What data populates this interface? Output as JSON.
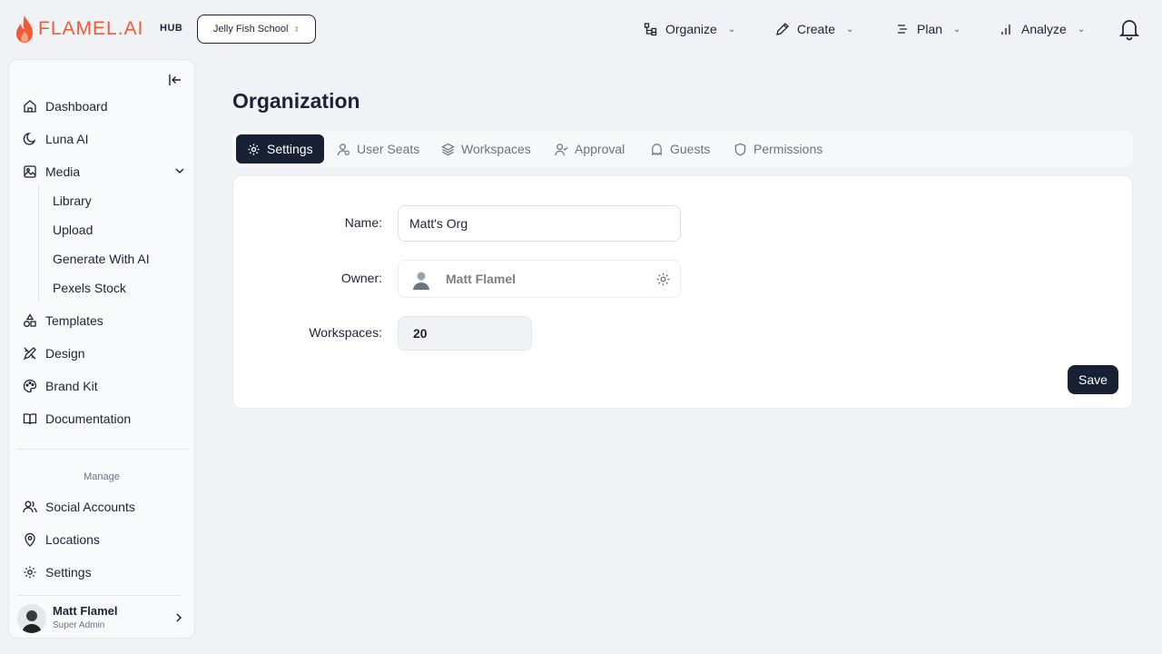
{
  "brand": {
    "logo_text": "FLAMEL.AI",
    "hub_label": "HUB",
    "accent": "#ef5a37"
  },
  "org_selector": {
    "value": "Jelly Fish School"
  },
  "topnav": [
    {
      "label": "Organize",
      "icon": "organize-icon"
    },
    {
      "label": "Create",
      "icon": "pen-icon"
    },
    {
      "label": "Plan",
      "icon": "plan-icon"
    },
    {
      "label": "Analyze",
      "icon": "bar-chart-icon"
    }
  ],
  "sidebar": {
    "items": [
      {
        "label": "Dashboard",
        "icon": "home-icon"
      },
      {
        "label": "Luna AI",
        "icon": "moon-icon"
      },
      {
        "label": "Media",
        "icon": "image-icon",
        "expanded": true
      }
    ],
    "media_sub": [
      "Library",
      "Upload",
      "Generate With AI",
      "Pexels Stock"
    ],
    "items2": [
      {
        "label": "Templates",
        "icon": "shapes-icon"
      },
      {
        "label": "Design",
        "icon": "design-icon"
      },
      {
        "label": "Brand Kit",
        "icon": "palette-icon"
      },
      {
        "label": "Documentation",
        "icon": "book-icon"
      }
    ],
    "manage_label": "Manage",
    "manage_items": [
      {
        "label": "Social Accounts",
        "icon": "users-icon"
      },
      {
        "label": "Locations",
        "icon": "map-pin-icon"
      },
      {
        "label": "Settings",
        "icon": "gear-icon"
      }
    ],
    "user": {
      "name": "Matt Flamel",
      "role": "Super Admin"
    }
  },
  "main": {
    "title": "Organization",
    "tabs": [
      {
        "label": "Settings",
        "icon": "gear-icon",
        "active": true
      },
      {
        "label": "User Seats",
        "icon": "user-icon"
      },
      {
        "label": "Workspaces",
        "icon": "layers-icon"
      },
      {
        "label": "Approval",
        "icon": "user-check-icon"
      },
      {
        "label": "Guests",
        "icon": "ghost-icon"
      },
      {
        "label": "Permissions",
        "icon": "shield-icon"
      }
    ],
    "form": {
      "name_label": "Name:",
      "name_value": "Matt's Org",
      "owner_label": "Owner:",
      "owner_value": "Matt Flamel",
      "workspaces_label": "Workspaces:",
      "workspaces_value": "20",
      "save_label": "Save"
    }
  }
}
